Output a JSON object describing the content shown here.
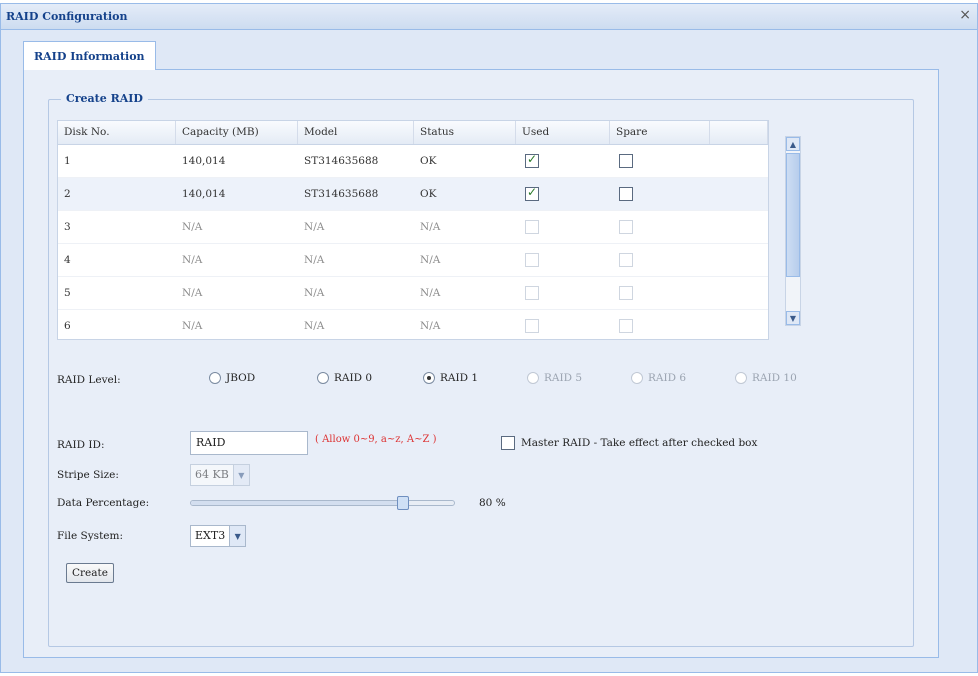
{
  "window": {
    "title": "RAID Configuration",
    "close_glyph": "×"
  },
  "tab": {
    "label": "RAID Information"
  },
  "section": {
    "legend": "Create RAID"
  },
  "grid": {
    "headers": [
      "Disk No.",
      "Capacity (MB)",
      "Model",
      "Status",
      "Used",
      "Spare"
    ],
    "rows": [
      {
        "disk": "1",
        "capacity": "140,014",
        "model": "ST314635688",
        "status": "OK",
        "used": true,
        "spare": false,
        "enabled": true
      },
      {
        "disk": "2",
        "capacity": "140,014",
        "model": "ST314635688",
        "status": "OK",
        "used": true,
        "spare": false,
        "enabled": true
      },
      {
        "disk": "3",
        "capacity": "N/A",
        "model": "N/A",
        "status": "N/A",
        "used": false,
        "spare": false,
        "enabled": false
      },
      {
        "disk": "4",
        "capacity": "N/A",
        "model": "N/A",
        "status": "N/A",
        "used": false,
        "spare": false,
        "enabled": false
      },
      {
        "disk": "5",
        "capacity": "N/A",
        "model": "N/A",
        "status": "N/A",
        "used": false,
        "spare": false,
        "enabled": false
      },
      {
        "disk": "6",
        "capacity": "N/A",
        "model": "N/A",
        "status": "N/A",
        "used": false,
        "spare": false,
        "enabled": false
      }
    ]
  },
  "scroll": {
    "up_icon": "chevron-up-icon",
    "down_icon": "chevron-down-icon",
    "up_glyph": "▲",
    "down_glyph": "▼"
  },
  "raid_level": {
    "label": "RAID Level:",
    "options": [
      {
        "label": "JBOD",
        "selected": false,
        "enabled": true
      },
      {
        "label": "RAID 0",
        "selected": false,
        "enabled": true
      },
      {
        "label": "RAID 1",
        "selected": true,
        "enabled": true
      },
      {
        "label": "RAID 5",
        "selected": false,
        "enabled": false
      },
      {
        "label": "RAID 6",
        "selected": false,
        "enabled": false
      },
      {
        "label": "RAID 10",
        "selected": false,
        "enabled": false
      }
    ]
  },
  "raid_id": {
    "label": "RAID ID:",
    "value": "RAID",
    "hint": "( Allow 0~9, a~z, A~Z )"
  },
  "master_raid": {
    "label": "Master RAID - Take effect after checked box",
    "checked": false
  },
  "stripe_size": {
    "label": "Stripe Size:",
    "value": "64 KB"
  },
  "data_percentage": {
    "label": "Data Percentage:",
    "value_text": "80 %",
    "fraction": 0.8
  },
  "file_system": {
    "label": "File System:",
    "value": "EXT3"
  },
  "create_button": {
    "label": "Create"
  },
  "colors": {
    "accent": "#15428b",
    "panel": "#dfe8f6",
    "border": "#99bbe8",
    "hint": "#dd3333"
  }
}
